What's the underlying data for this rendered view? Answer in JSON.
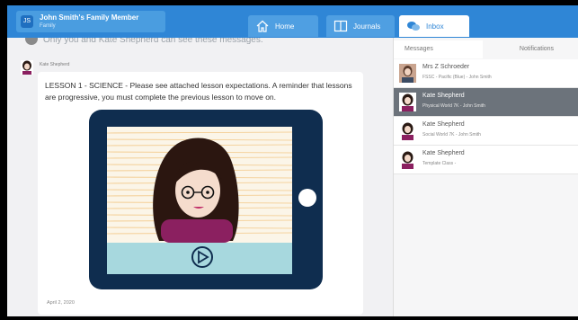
{
  "account": {
    "initials": "JS",
    "name": "John Smith's Family Member",
    "subtitle": "Family"
  },
  "tabs": {
    "home": "Home",
    "journals": "Journals",
    "inbox": "Inbox"
  },
  "thread": {
    "privacy_notice": "Only you and Kate Shepherd can see these messages.",
    "sender": "Kate Shepherd",
    "message": "LESSON 1 - SCIENCE - Please see attached lesson expectations. A reminder that lessons are progressive, you must complete the previous lesson to move on.",
    "date": "April 2, 2020"
  },
  "inbox": {
    "tabs": {
      "messages": "Messages",
      "notifications": "Notifications"
    },
    "conversations": [
      {
        "name": "Mrs Z Schroeder",
        "detail": "FSSC - Pacific (Blue) - John Smith",
        "active": false
      },
      {
        "name": "Kate Shepherd",
        "detail": "Physical World 7K - John Smith",
        "active": true
      },
      {
        "name": "Kate Shepherd",
        "detail": "Social World 7K - John Smith",
        "active": false
      },
      {
        "name": "Kate Shepherd",
        "detail": "Template Class -",
        "active": false
      }
    ]
  },
  "colors": {
    "brand_blue": "#2f86d6",
    "tablet_navy": "#0f2d4f",
    "active_row": "#6c737b"
  }
}
